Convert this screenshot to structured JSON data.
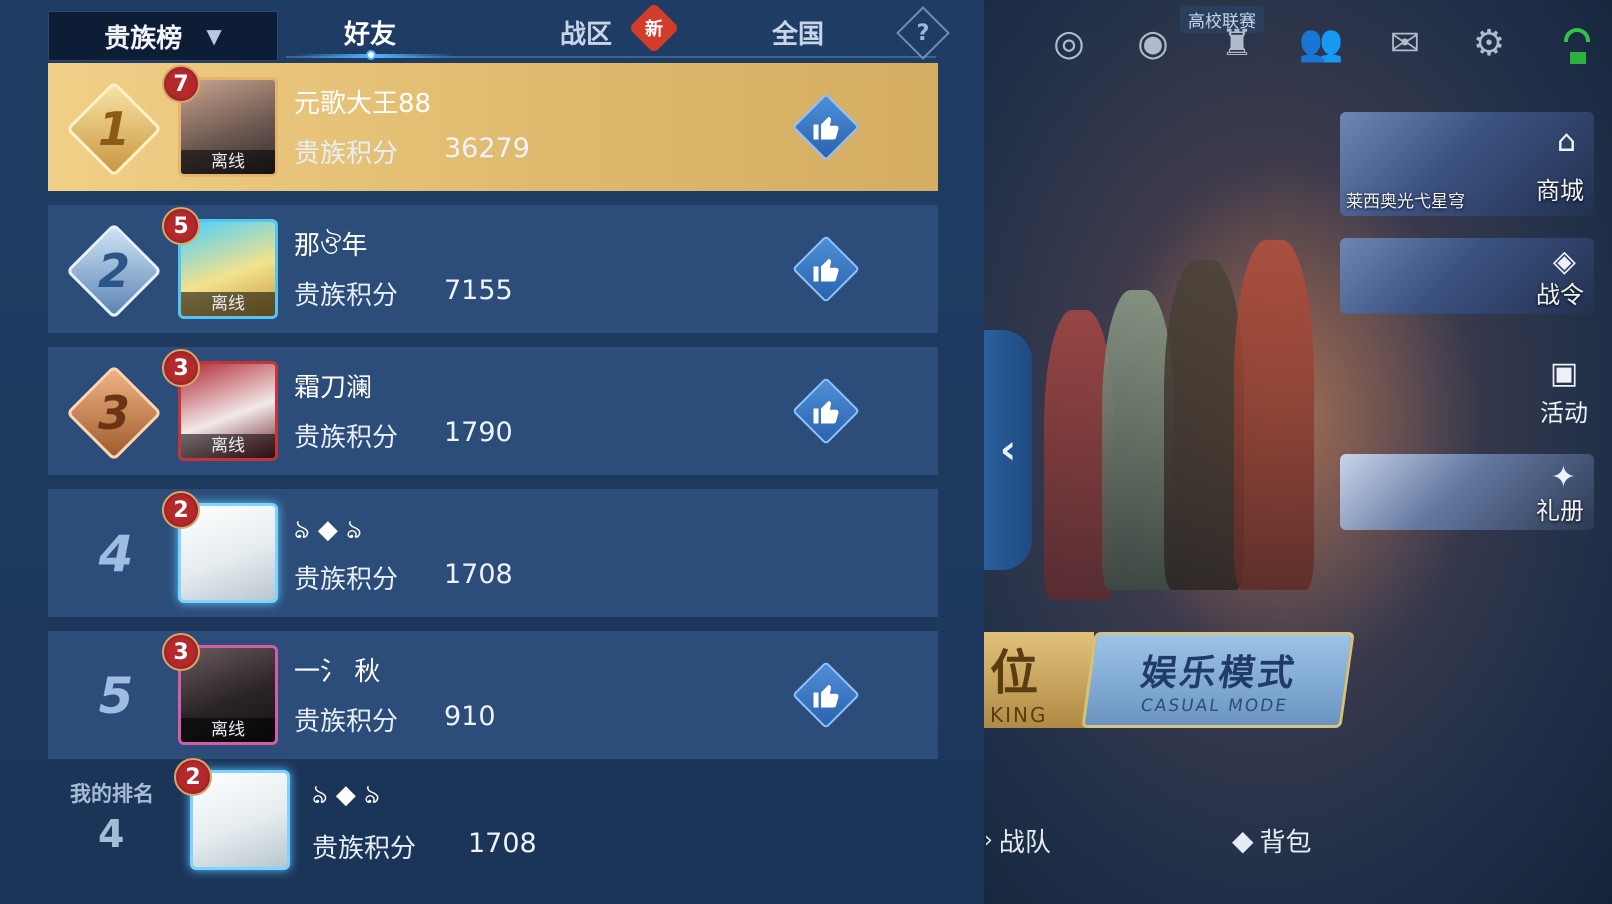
{
  "leaderboard": {
    "title_select": "贵族榜",
    "tabs": [
      {
        "label": "好友",
        "active": true
      },
      {
        "label": "战区",
        "badge": "新"
      },
      {
        "label": "全国"
      }
    ],
    "score_label": "贵族积分",
    "offline_label": "离线",
    "entries": [
      {
        "rank": "1",
        "level": "7",
        "name": "元歌大王88",
        "score": "36279",
        "offline": true
      },
      {
        "rank": "2",
        "level": "5",
        "name": "那ঔ年",
        "score": "7155",
        "offline": true
      },
      {
        "rank": "3",
        "level": "3",
        "name": "霜刀澜",
        "score": "1790",
        "offline": true
      },
      {
        "rank": "4",
        "level": "2",
        "name": "ঌ  ◆  ঌ",
        "score": "1708",
        "offline": false
      },
      {
        "rank": "5",
        "level": "3",
        "name": "一氵 秋",
        "score": "910",
        "offline": true
      }
    ],
    "my_rank": {
      "label": "我的排名",
      "rank": "4",
      "level": "2",
      "name": "ঌ  ◆  ঌ",
      "score": "1708"
    }
  },
  "lobby": {
    "top_badge": "高校联赛",
    "side": {
      "shop_label": "商城",
      "shop_skin": "莱西奥光弋星穹",
      "battlepass_label": "战令",
      "events_label": "活动",
      "gift_label": "礼册"
    },
    "ranked_char": "位",
    "ranked_sub": "KING",
    "casual_title": "娱乐模式",
    "casual_sub": "CASUAL MODE",
    "bottom": {
      "team_label": "战队",
      "bag_label": "背包"
    }
  },
  "colors": {
    "gold_row": "#e6c377",
    "row": "#2c4d79",
    "accent": "#4fb6ff"
  }
}
